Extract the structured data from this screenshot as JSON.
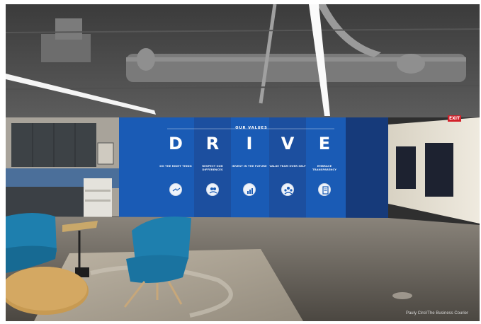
{
  "wall": {
    "section_title": "OUR VALUES",
    "values": [
      {
        "letter": "D",
        "caption": "DO THE RIGHT THING",
        "icon": "handshake-icon"
      },
      {
        "letter": "R",
        "caption": "RESPECT OUR DIFFERENCES",
        "icon": "people-icon"
      },
      {
        "letter": "I",
        "caption": "INVEST IN THE FUTURE",
        "icon": "growth-chart-icon"
      },
      {
        "letter": "V",
        "caption": "VALUE TEAM OVER SELF",
        "icon": "team-icon"
      },
      {
        "letter": "E",
        "caption": "EMBRACE TRANSPARENCY",
        "icon": "document-icon"
      }
    ]
  },
  "exit_sign": "EXIT",
  "photo_credit": "Pauly Circi/The Business Courier",
  "colors": {
    "wall_blue": "#1a5bb5",
    "wall_navy": "#163a7a",
    "chair_teal": "#1e7fae",
    "floor": "#6f6a63"
  }
}
